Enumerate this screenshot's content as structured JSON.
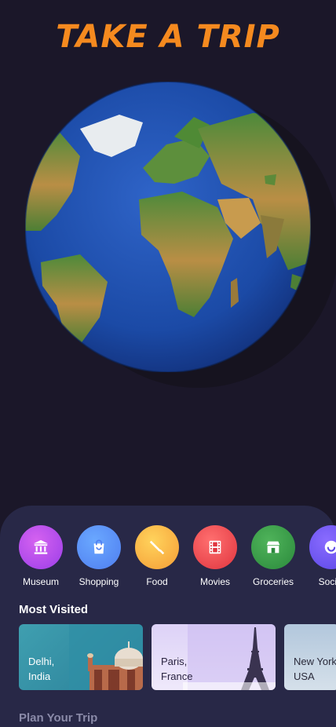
{
  "header": {
    "title": "TAKE A TRIP"
  },
  "categories": [
    {
      "label": "Museum",
      "icon": "museum-icon",
      "color_from": "#d562f0",
      "color_to": "#9b3ee8"
    },
    {
      "label": "Shopping",
      "icon": "shopping-bag-icon",
      "color_from": "#6aa8ff",
      "color_to": "#4f7ef0"
    },
    {
      "label": "Food",
      "icon": "food-icon",
      "color_from": "#ffd35c",
      "color_to": "#f59d36"
    },
    {
      "label": "Movies",
      "icon": "film-icon",
      "color_from": "#ff6f6f",
      "color_to": "#e0353f"
    },
    {
      "label": "Groceries",
      "icon": "store-icon",
      "color_from": "#4fb35a",
      "color_to": "#2b8a3c"
    },
    {
      "label": "Social",
      "icon": "smile-icon",
      "color_from": "#8a6cff",
      "color_to": "#5b47e6"
    }
  ],
  "most_visited": {
    "title": "Most Visited",
    "cards": [
      {
        "city": "Delhi,",
        "country": "India"
      },
      {
        "city": "Paris,",
        "country": "France"
      },
      {
        "city": "New York,",
        "country": "USA"
      }
    ]
  },
  "plan": {
    "title": "Plan Your Trip"
  }
}
